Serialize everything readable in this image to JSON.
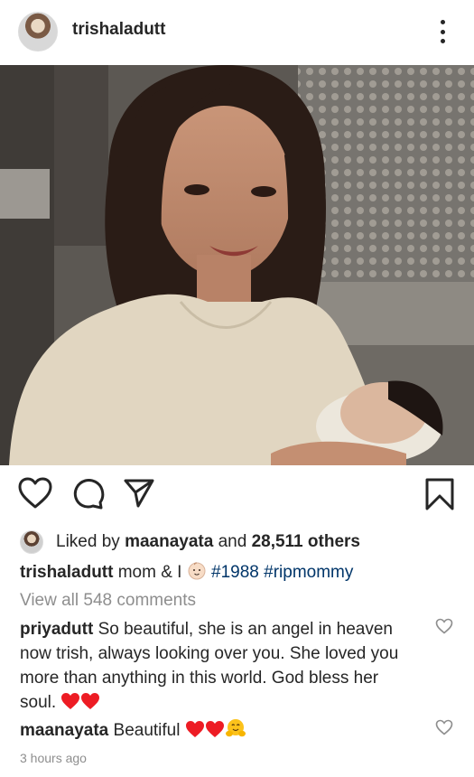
{
  "post": {
    "username": "trishaladutt",
    "more_icon": "more-vertical-icon"
  },
  "actions": {
    "icons": [
      "heart-icon",
      "comment-icon",
      "share-icon",
      "bookmark-icon"
    ]
  },
  "likes": {
    "prefix": "Liked by",
    "user": "maanayata",
    "conjunction": "and",
    "others": "28,511 others"
  },
  "caption": {
    "username": "trishaladutt",
    "text": "mom & I",
    "emoji": "baby-emoji",
    "hashtag_1": "#1988",
    "hashtag_2": "#ripmommy"
  },
  "view_all_comments": "View all 548 comments",
  "comments": [
    {
      "username": "priyadutt",
      "line_1": "So beautiful, she is an angel in heaven",
      "line_2": "now trish, always looking over you. She loved you",
      "line_3": "more than anything in this world. God bless her",
      "line_4": "soul.",
      "emojis": [
        "red-heart-icon",
        "red-heart-icon"
      ]
    },
    {
      "username": "maanayata",
      "text": "Beautiful",
      "emojis": [
        "red-heart-icon",
        "red-heart-icon",
        "hugging-face-icon"
      ]
    }
  ],
  "timestamp": "3 hours ago",
  "colors": {
    "text": "#262626",
    "muted": "#8e8e8e",
    "hashtag": "#003569",
    "heart": "#ed1c24"
  }
}
